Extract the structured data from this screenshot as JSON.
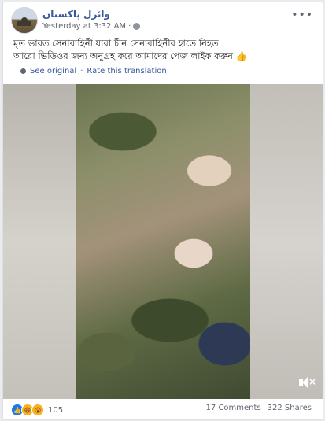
{
  "post": {
    "page_name": "وائرل پاکستان",
    "timestamp": "Yesterday at 3:32 AM",
    "more_glyph": "•••",
    "text_line1": "মৃত ভারত সেনাবাহিনী যারা চীন সেনাবাহিনীর হাতে নিহত",
    "text_line2": "আরো ভিডিওর জন্য অনুগ্রহ করে আমাদের পেজ লাইক করুন 👍",
    "see_original": "See original",
    "rate_translation": "Rate this translation",
    "separator": "·"
  },
  "icons": {
    "globe": "globe-icon",
    "settings": "gear-icon",
    "mute": "volume-muted-icon",
    "like": "like-reaction-icon",
    "haha": "haha-reaction-icon",
    "wow": "wow-reaction-icon"
  },
  "reactions": {
    "like_glyph": "👍",
    "haha_glyph": "😆",
    "wow_glyph": "😮",
    "count": "105"
  },
  "stats": {
    "comments": "17 Comments",
    "shares": "322 Shares"
  },
  "colors": {
    "link": "#385898",
    "like": "#1877f2",
    "emoji": "#f7b125",
    "muted_text": "#606770"
  }
}
